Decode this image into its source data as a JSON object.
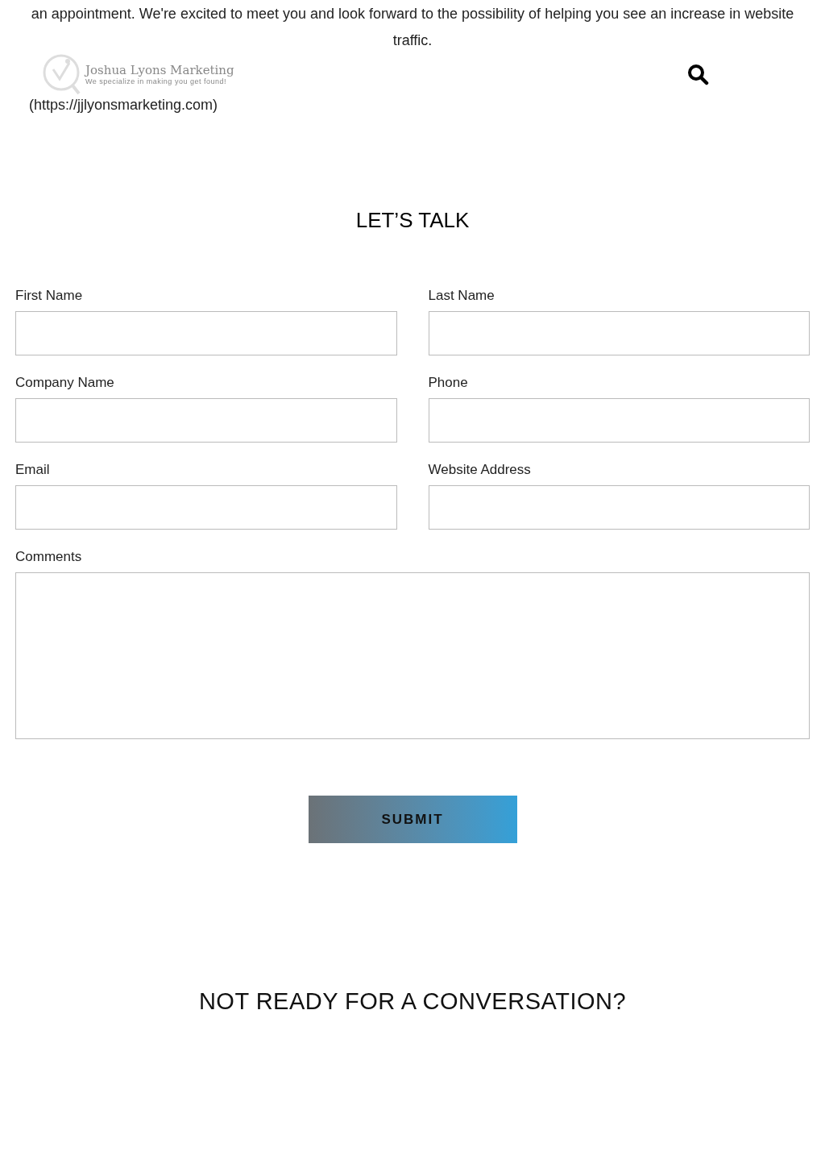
{
  "intro": "an appointment. We're excited to meet you and look forward to the possibility of helping you see an increase in website traffic.",
  "logo": {
    "name": "Joshua Lyons Marketing",
    "tagline": "We specialize in making you get found!"
  },
  "logo_link": "(https://jjlyonsmarketing.com)",
  "heading": "LET’S TALK",
  "fields": [
    {
      "label": "First Name",
      "kind": "input"
    },
    {
      "label": "Last Name",
      "kind": "input"
    },
    {
      "label": "Company Name",
      "kind": "input"
    },
    {
      "label": "Phone",
      "kind": "input"
    },
    {
      "label": "Email",
      "kind": "input"
    },
    {
      "label": "Website Address",
      "kind": "input"
    },
    {
      "label": "Comments",
      "kind": "textarea"
    }
  ],
  "submit": "SUBMIT",
  "footer_heading": "NOT READY FOR A CONVERSATION?"
}
